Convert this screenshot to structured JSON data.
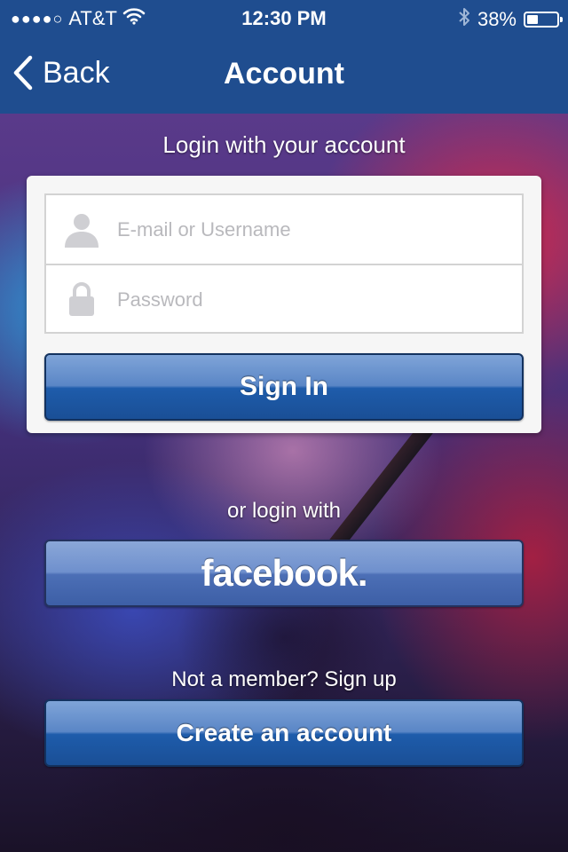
{
  "status_bar": {
    "signal": "●●●●○",
    "carrier": "AT&T",
    "time": "12:30 PM",
    "battery_percent": "38%",
    "battery_level": 0.38,
    "icons": [
      "wifi-icon",
      "bluetooth-icon",
      "battery-icon"
    ]
  },
  "nav": {
    "back_label": "Back",
    "title": "Account"
  },
  "login": {
    "heading": "Login with your account",
    "username_placeholder": "E-mail or Username",
    "username_value": "",
    "password_placeholder": "Password",
    "password_value": "",
    "signin_label": "Sign In"
  },
  "social": {
    "or_label": "or login with",
    "facebook_label": "facebook."
  },
  "signup": {
    "prompt": "Not a member? Sign up",
    "create_label": "Create an account"
  },
  "colors": {
    "nav_bg": "#1f4d8f",
    "button_blue": "#1e5cab",
    "facebook_blue": "#4c6fb6"
  }
}
